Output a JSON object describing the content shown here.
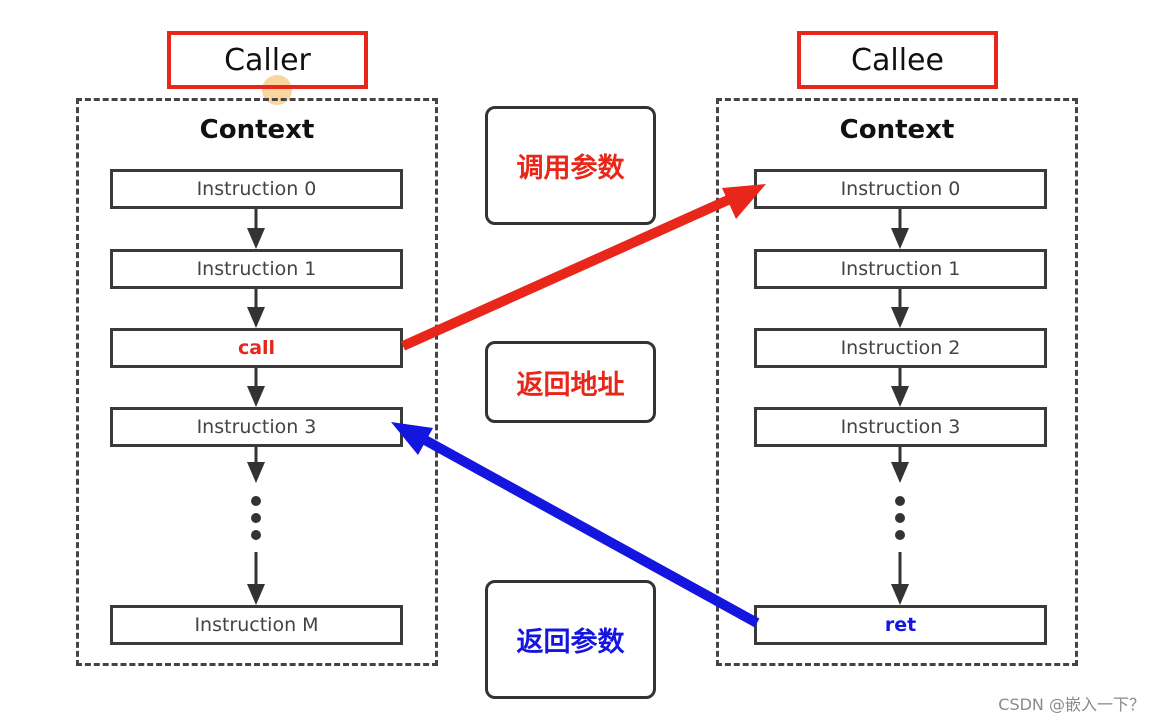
{
  "caller": {
    "label": "Caller",
    "context_title": "Context",
    "instructions": [
      {
        "text": "Instruction 0",
        "kind": "normal"
      },
      {
        "text": "Instruction 1",
        "kind": "normal"
      },
      {
        "text": "call",
        "kind": "call"
      },
      {
        "text": "Instruction 3",
        "kind": "normal"
      },
      {
        "text": "Instruction M",
        "kind": "normal"
      }
    ]
  },
  "callee": {
    "label": "Callee",
    "context_title": "Context",
    "instructions": [
      {
        "text": "Instruction 0",
        "kind": "normal"
      },
      {
        "text": "Instruction 1",
        "kind": "normal"
      },
      {
        "text": "Instruction 2",
        "kind": "normal"
      },
      {
        "text": "Instruction 3",
        "kind": "normal"
      },
      {
        "text": "ret",
        "kind": "ret"
      }
    ]
  },
  "middle": {
    "call_args": "调用参数",
    "return_address": "返回地址",
    "return_values": "返回参数"
  },
  "colors": {
    "call_arrow": "#e8261a",
    "return_arrow": "#1515e0",
    "flow_arrow": "#333333"
  },
  "watermark": "CSDN @嵌入一下？"
}
